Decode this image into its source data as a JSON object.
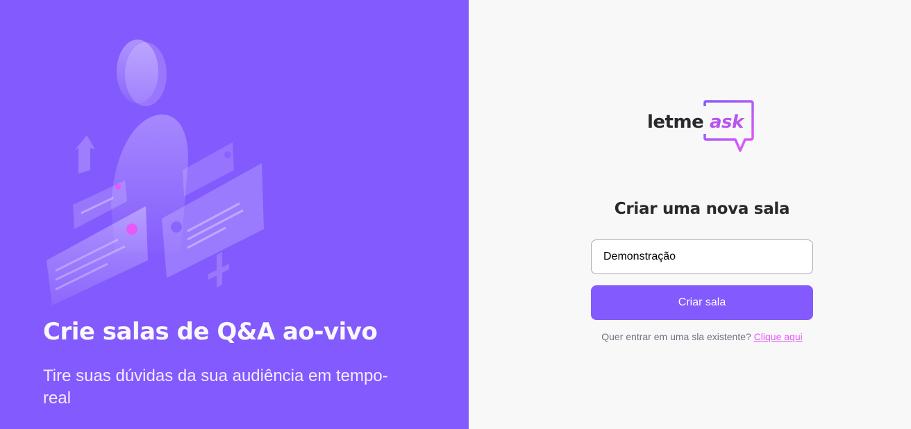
{
  "aside": {
    "title": "Crie salas de Q&A ao-vivo",
    "subtitle": "Tire suas dúvidas da sua audiência em tempo-real"
  },
  "logo": {
    "part1": "letme",
    "part2": "ask"
  },
  "form": {
    "title": "Criar uma nova sala",
    "input_value": "Demonstração",
    "submit_label": "Criar sala",
    "join_prompt": "Quer entrar em uma sla existente?",
    "join_link": "Clique aqui"
  },
  "colors": {
    "primary": "#835afd",
    "accent_pink": "#e559f9",
    "background": "#f8f8f8",
    "text_dark": "#29292e"
  }
}
